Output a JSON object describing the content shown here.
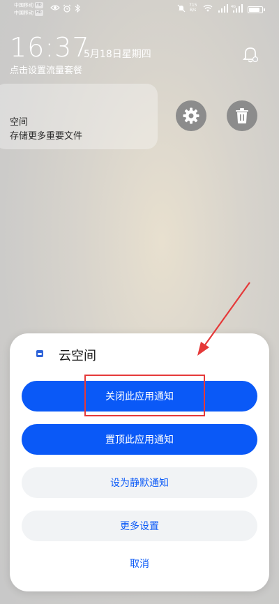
{
  "status_bar": {
    "carrier1": "中国移动",
    "carrier2": "中国移动",
    "hd": "HD",
    "net_speed": "715",
    "net_unit": "B/s",
    "signal_tag": "4G",
    "battery_level": 0.9
  },
  "lockscreen": {
    "time": "16:37",
    "date": "5月18日星期四",
    "data_plan": "点击设置流量套餐"
  },
  "notification": {
    "title": "空间",
    "text": "存储更多重要文件"
  },
  "sheet": {
    "app_name": "云空间",
    "buttons": {
      "close_notify": "关闭此应用通知",
      "pin_notify": "置顶此应用通知",
      "silent_notify": "设为静默通知",
      "more_settings": "更多设置"
    },
    "cancel": "取消"
  },
  "colors": {
    "accent": "#0a59f7",
    "annotation": "#e53939"
  }
}
